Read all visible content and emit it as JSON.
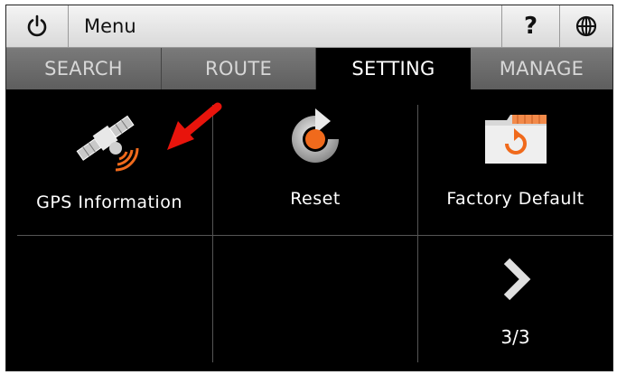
{
  "titlebar": {
    "menu_label": "Menu",
    "help_label": "?",
    "icons": [
      "power-icon",
      "globe-icon"
    ]
  },
  "tabs": [
    {
      "label": "SEARCH",
      "active": false
    },
    {
      "label": "ROUTE",
      "active": false
    },
    {
      "label": "SETTING",
      "active": true
    },
    {
      "label": "MANAGE",
      "active": false
    }
  ],
  "items": [
    {
      "label": "GPS Information",
      "icon": "satellite-icon"
    },
    {
      "label": "Reset",
      "icon": "reset-icon"
    },
    {
      "label": "Factory Default",
      "icon": "folder-restore-icon"
    }
  ],
  "pager": {
    "text": "3/3",
    "icon": "chevron-right-icon"
  },
  "annotation": {
    "icon": "red-arrow-icon",
    "color": "#e8140c"
  },
  "colors": {
    "accent": "#f06a1c",
    "background": "#000000"
  }
}
